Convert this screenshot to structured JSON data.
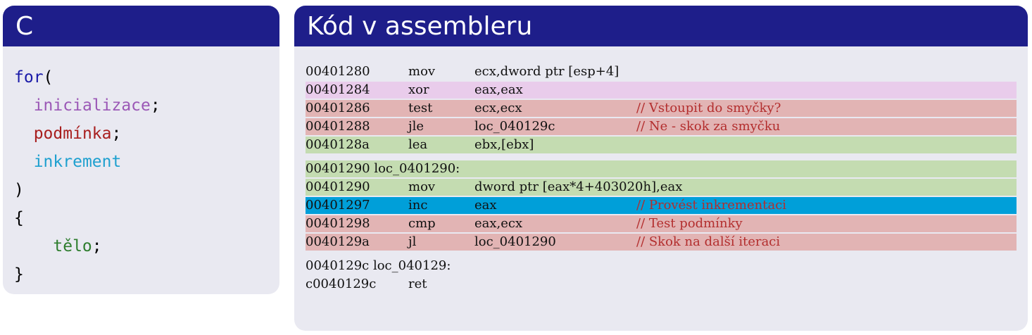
{
  "c_block": {
    "title": "C",
    "lines": [
      {
        "text": "for",
        "after": "(",
        "color": "#1a1aa8",
        "indent": 0
      },
      {
        "text": "inicializace",
        "after": ";",
        "color": "#9b58b6",
        "indent": 2
      },
      {
        "text": "podmínka",
        "after": ";",
        "color": "#a81e1e",
        "indent": 2
      },
      {
        "text": "inkrement",
        "after": "",
        "color": "#1ea0cf",
        "indent": 2
      },
      {
        "text": ")",
        "after": "",
        "color": "#000000",
        "indent": 0
      },
      {
        "text": "{",
        "after": "",
        "color": "#000000",
        "indent": 0
      },
      {
        "text": "tělo",
        "after": ";",
        "color": "#2e7d2e",
        "indent": 4
      },
      {
        "text": "}",
        "after": "",
        "color": "#000000",
        "indent": 0
      }
    ]
  },
  "asm_block": {
    "title": "Kód v assembleru",
    "highlight_colors": {
      "purple": "#e9cceb",
      "red": "#e2b4b4",
      "green": "#c4dcb1",
      "blue": "#009fd9"
    },
    "rows": [
      {
        "addr": "00401280",
        "mnemonic": "mov",
        "operands": "ecx,dword ptr [esp+4]",
        "comment": "",
        "hl": "none"
      },
      {
        "addr": "00401284",
        "mnemonic": "xor",
        "operands": "eax,eax",
        "comment": "",
        "hl": "purple"
      },
      {
        "addr": "00401286",
        "mnemonic": "test",
        "operands": "ecx,ecx",
        "comment": "// Vstoupit do smyčky?",
        "hl": "red"
      },
      {
        "addr": "00401288",
        "mnemonic": "jle",
        "operands": "loc_040129c",
        "comment": "// Ne - skok za smyčku",
        "hl": "red"
      },
      {
        "addr": "0040128a",
        "mnemonic": "lea",
        "operands": "ebx,[ebx]",
        "comment": "",
        "hl": "green"
      },
      {
        "label": "00401290 loc_0401290:",
        "hl": "green",
        "gap": true
      },
      {
        "addr": "00401290",
        "mnemonic": "mov",
        "operands": "dword ptr [eax*4+403020h],eax",
        "comment": "",
        "hl": "green"
      },
      {
        "addr": "00401297",
        "mnemonic": "inc",
        "operands": "eax",
        "comment": "// Provést inkrementaci",
        "hl": "blue"
      },
      {
        "addr": "00401298",
        "mnemonic": "cmp",
        "operands": "eax,ecx",
        "comment": "// Test podmínky",
        "hl": "red"
      },
      {
        "addr": "0040129a",
        "mnemonic": "jl",
        "operands": "loc_0401290",
        "comment": "// Skok na další iteraci",
        "hl": "red"
      },
      {
        "label": "0040129c loc_040129:",
        "hl": "none",
        "gap": true
      },
      {
        "addr": "c0040129c",
        "mnemonic": "ret",
        "operands": "",
        "comment": "",
        "hl": "none"
      }
    ]
  }
}
